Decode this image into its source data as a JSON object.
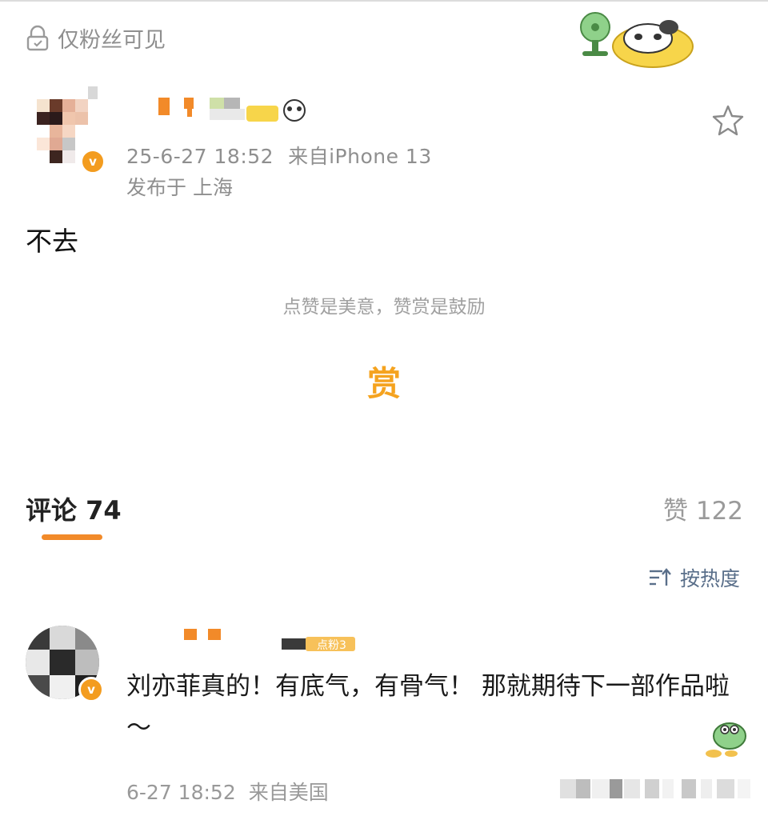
{
  "post": {
    "visibility_label": "仅粉丝可见",
    "date": "25-6-27 18:52",
    "source": "来自iPhone 13",
    "location": "发布于 上海",
    "content": "不去",
    "reward_tip": "点赞是美意，赞赏是鼓励",
    "reward_label": "赏",
    "verified_badge": "v"
  },
  "tabs": {
    "comments_label": "评论 74",
    "likes_label": "赞 122"
  },
  "sort": {
    "label": "按热度",
    "icon": "sort-icon"
  },
  "comments": [
    {
      "text": "刘亦菲真的！有底气，有骨气！ 那就期待下一部作品啦～",
      "date": "6-27 18:52",
      "source": "来自美国",
      "badge_text": "点粉3",
      "verified_badge": "v"
    }
  ],
  "colors": {
    "accent": "#f28a29",
    "reward": "#f5a31f",
    "secondary_text": "#8f8f8f",
    "sort_text": "#5a6f8a"
  }
}
